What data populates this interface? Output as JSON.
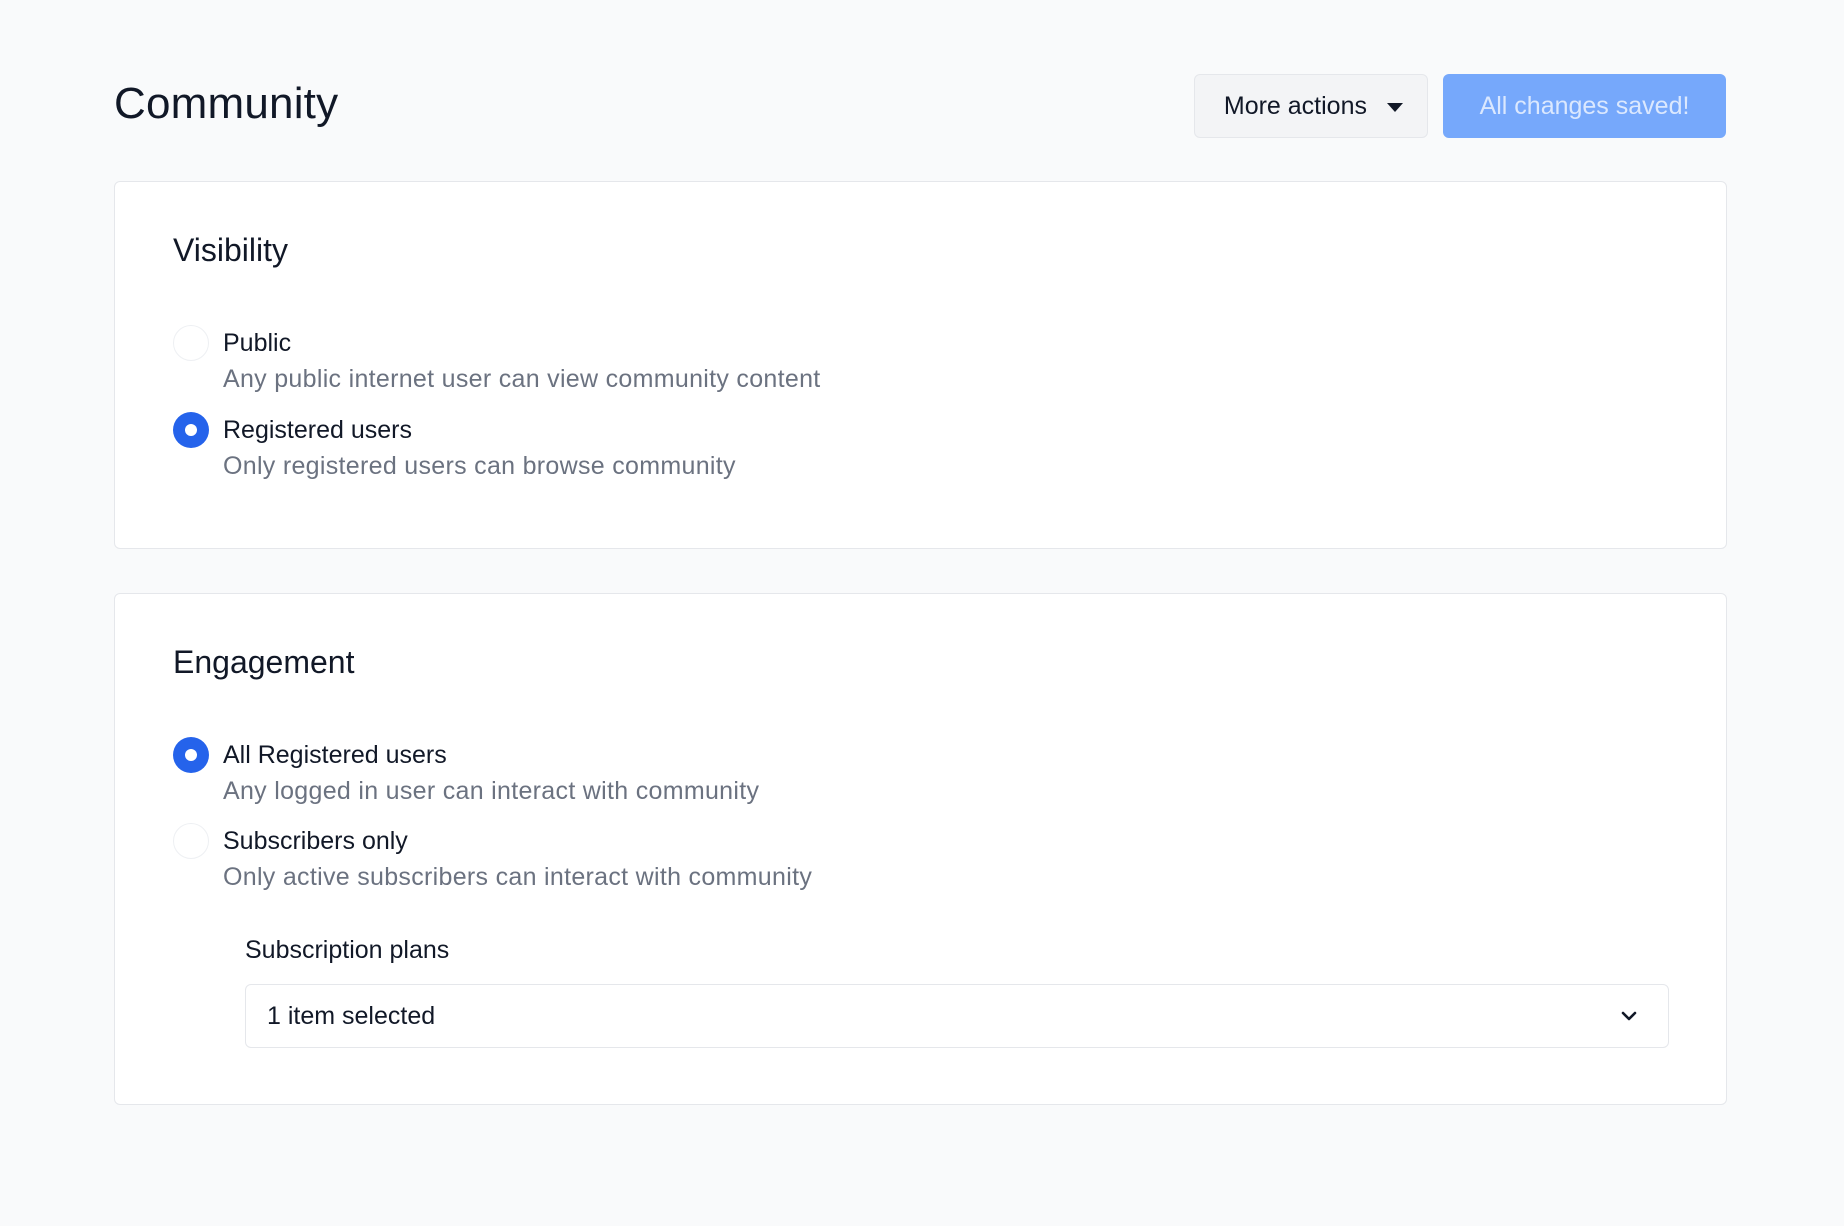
{
  "header": {
    "title": "Community",
    "more_actions_label": "More actions",
    "saved_label": "All changes saved!"
  },
  "visibility": {
    "title": "Visibility",
    "options": [
      {
        "label": "Public",
        "description": "Any public internet user can view community content",
        "checked": false
      },
      {
        "label": "Registered users",
        "description": "Only registered users can browse community",
        "checked": true
      }
    ]
  },
  "engagement": {
    "title": "Engagement",
    "options": [
      {
        "label": "All Registered users",
        "description": "Any logged in user can interact with community",
        "checked": true
      },
      {
        "label": "Subscribers only",
        "description": "Only active subscribers can interact with community",
        "checked": false
      }
    ],
    "plans_label": "Subscription plans",
    "plans_value": "1 item selected"
  },
  "icons": {
    "more_actions": "caret-down-icon",
    "select": "chevron-down-icon"
  },
  "colors": {
    "accent": "#2563eb",
    "saved_button": "#76a8fb",
    "background": "#f9fafb"
  }
}
